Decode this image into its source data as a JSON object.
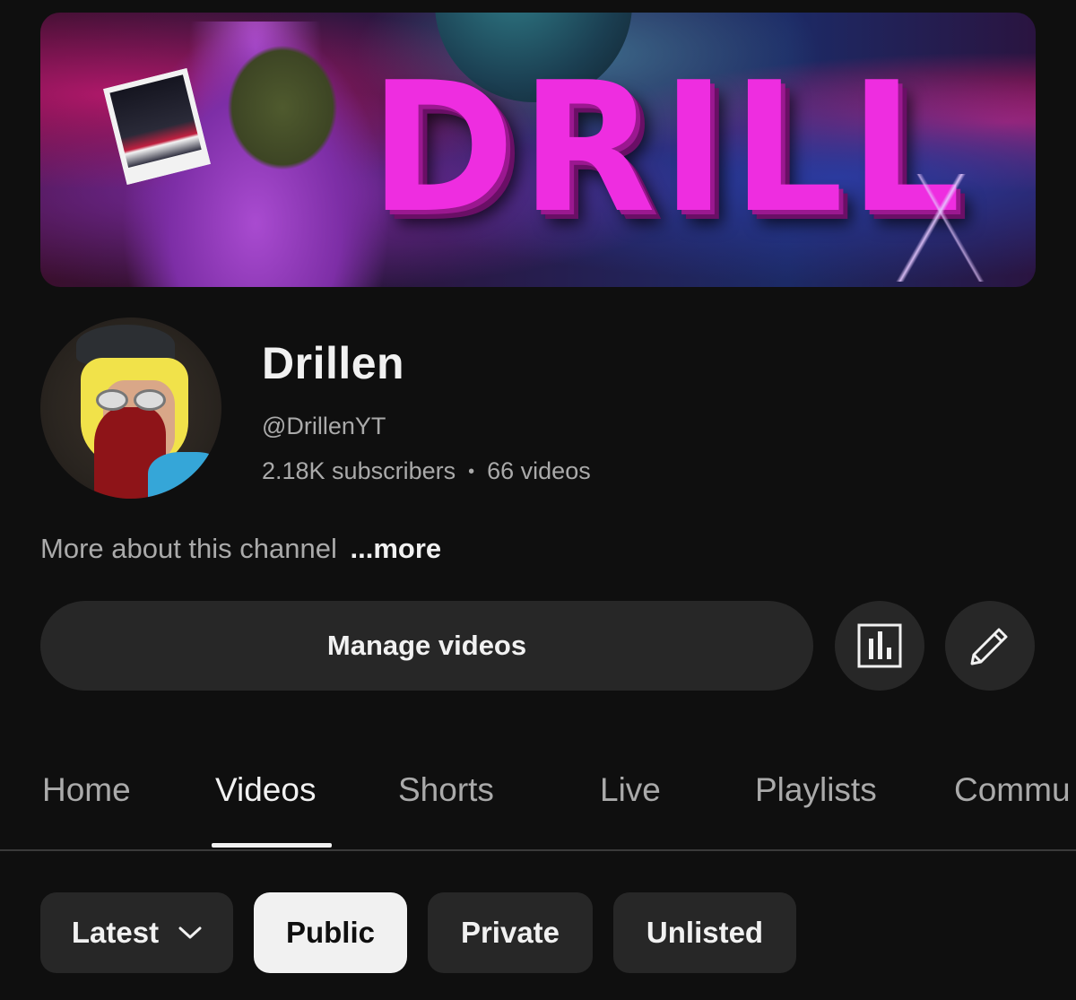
{
  "banner": {
    "word": "DRILL"
  },
  "channel": {
    "name": "Drillen",
    "handle": "@DrillenYT",
    "subscribers": "2.18K subscribers",
    "separator": "•",
    "videos": "66 videos",
    "about_text": "More about this channel",
    "more_label": "...more"
  },
  "actions": {
    "manage_label": "Manage videos",
    "analytics_icon": "analytics-icon",
    "edit_icon": "pencil-icon"
  },
  "tabs": [
    {
      "label": "Home"
    },
    {
      "label": "Videos",
      "active": true
    },
    {
      "label": "Shorts"
    },
    {
      "label": "Live"
    },
    {
      "label": "Playlists"
    },
    {
      "label": "Commu"
    }
  ],
  "filters": {
    "sort_label": "Latest",
    "chips": [
      {
        "label": "Public",
        "selected": true
      },
      {
        "label": "Private"
      },
      {
        "label": "Unlisted"
      }
    ]
  },
  "colors": {
    "background": "#0f0f0f",
    "surface": "#272727",
    "text_primary": "#f1f1f1",
    "text_secondary": "#aaaaaa",
    "banner_accent": "#ee2de0"
  }
}
